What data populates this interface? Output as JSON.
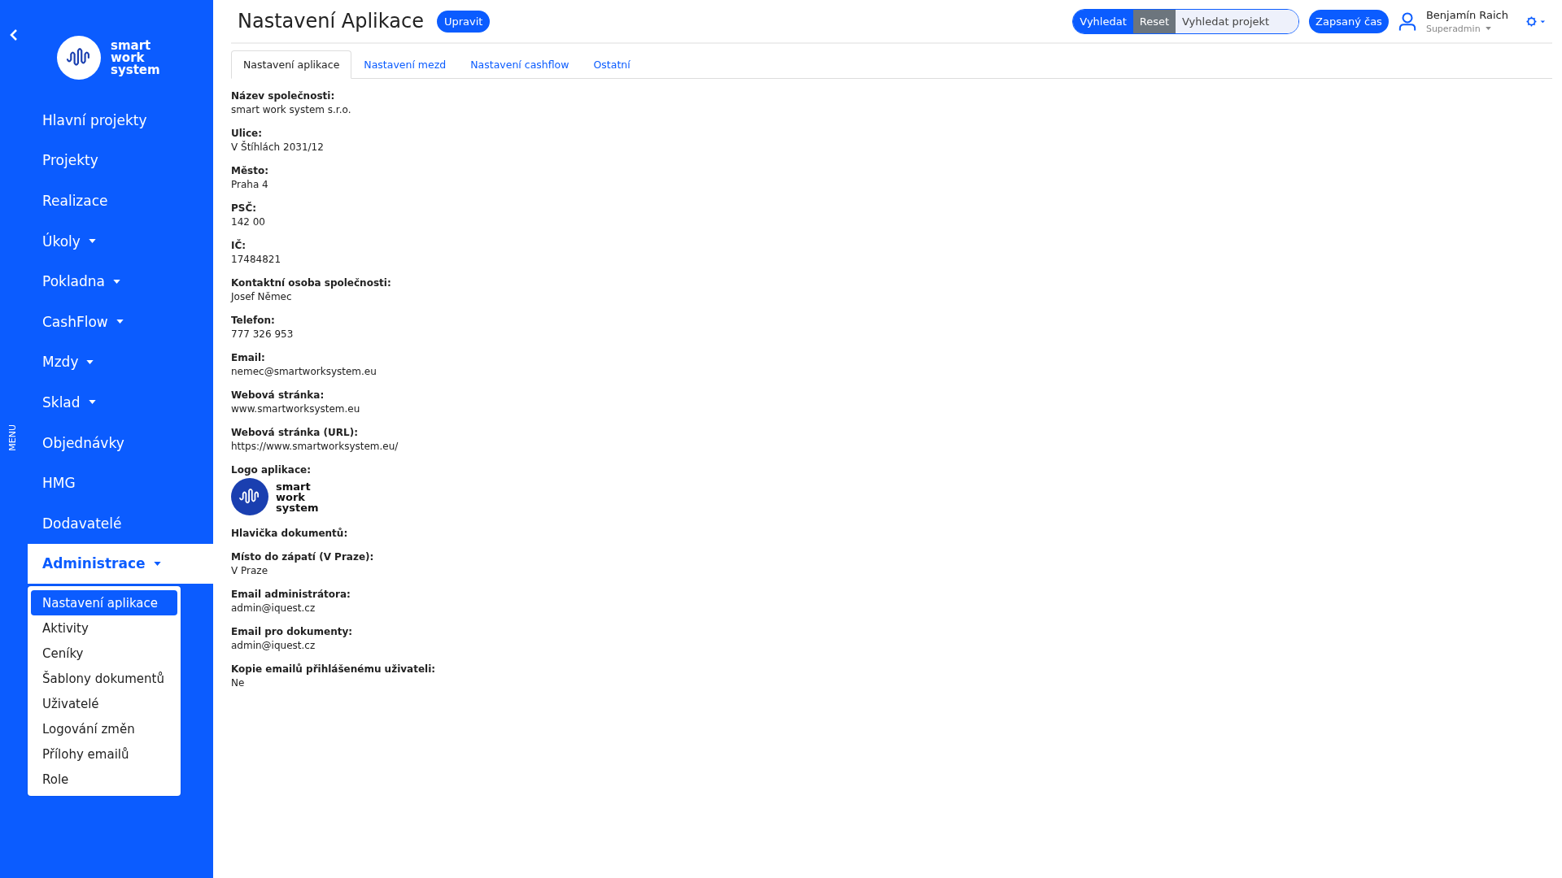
{
  "sidebar": {
    "menu_label": "MENU",
    "logo_text": "smart work system",
    "items": [
      {
        "label": "Hlavní projekty",
        "dropdown": false,
        "selected": false
      },
      {
        "label": "Projekty",
        "dropdown": false,
        "selected": false
      },
      {
        "label": "Realizace",
        "dropdown": false,
        "selected": false
      },
      {
        "label": "Úkoly",
        "dropdown": true,
        "selected": false
      },
      {
        "label": "Pokladna",
        "dropdown": true,
        "selected": false
      },
      {
        "label": "CashFlow",
        "dropdown": true,
        "selected": false
      },
      {
        "label": "Mzdy",
        "dropdown": true,
        "selected": false
      },
      {
        "label": "Sklad",
        "dropdown": true,
        "selected": false
      },
      {
        "label": "Objednávky",
        "dropdown": false,
        "selected": false
      },
      {
        "label": "HMG",
        "dropdown": false,
        "selected": false
      },
      {
        "label": "Dodavatelé",
        "dropdown": false,
        "selected": false
      },
      {
        "label": "Administrace",
        "dropdown": true,
        "selected": true,
        "expanded": true,
        "children": [
          {
            "label": "Nastavení aplikace",
            "selected": true
          },
          {
            "label": "Aktivity",
            "selected": false
          },
          {
            "label": "Ceníky",
            "selected": false
          },
          {
            "label": "Šablony dokumentů",
            "selected": false
          },
          {
            "label": "Uživatelé",
            "selected": false
          },
          {
            "label": "Logování změn",
            "selected": false
          },
          {
            "label": "Přílohy emailů",
            "selected": false
          },
          {
            "label": "Role",
            "selected": false
          }
        ]
      }
    ]
  },
  "header": {
    "title": "Nastavení Aplikace",
    "edit_button": "Upravit",
    "search_button": "Vyhledat",
    "reset_button": "Reset",
    "search": {
      "placeholder": "Vyhledat projekt"
    },
    "time_button": "Zapsaný čas",
    "user": {
      "name": "Benjamín Raich",
      "role": "Superadmin"
    }
  },
  "tabs": [
    {
      "label": "Nastavení aplikace",
      "selected": true
    },
    {
      "label": "Nastavení mezd",
      "selected": false
    },
    {
      "label": "Nastavení cashflow",
      "selected": false
    },
    {
      "label": "Ostatní",
      "selected": false
    }
  ],
  "fields": [
    {
      "kind": "text",
      "label": "Název společnosti:",
      "value": "smart work system s.r.o."
    },
    {
      "kind": "text",
      "label": "Ulice:",
      "value": "V Štíhlách 2031/12"
    },
    {
      "kind": "text",
      "label": "Město:",
      "value": "Praha 4"
    },
    {
      "kind": "text",
      "label": "PSČ:",
      "value": "142 00"
    },
    {
      "kind": "text",
      "label": "IČ:",
      "value": "17484821"
    },
    {
      "kind": "text",
      "label": "Kontaktní osoba společnosti:",
      "value": "Josef Němec"
    },
    {
      "kind": "text",
      "label": "Telefon:",
      "value": "777 326 953"
    },
    {
      "kind": "text",
      "label": "Email:",
      "value": "nemec@smartworksystem.eu"
    },
    {
      "kind": "text",
      "label": "Webová stránka:",
      "value": "www.smartworksystem.eu"
    },
    {
      "kind": "text",
      "label": "Webová stránka (URL):",
      "value": "https://www.smartworksystem.eu/"
    },
    {
      "kind": "logo",
      "label": "Logo aplikace:",
      "value": "smart work system"
    },
    {
      "kind": "empty",
      "label": "Hlavička dokumentů:"
    },
    {
      "kind": "text",
      "label": "Místo do zápatí (V Praze):",
      "value": "V Praze"
    },
    {
      "kind": "text",
      "label": "Email administrátora:",
      "value": "admin@iquest.cz"
    },
    {
      "kind": "text",
      "label": "Email pro dokumenty:",
      "value": "admin@iquest.cz"
    },
    {
      "kind": "text",
      "label": "Kopie emailů přihlášenému uživateli:",
      "value": "Ne"
    }
  ]
}
